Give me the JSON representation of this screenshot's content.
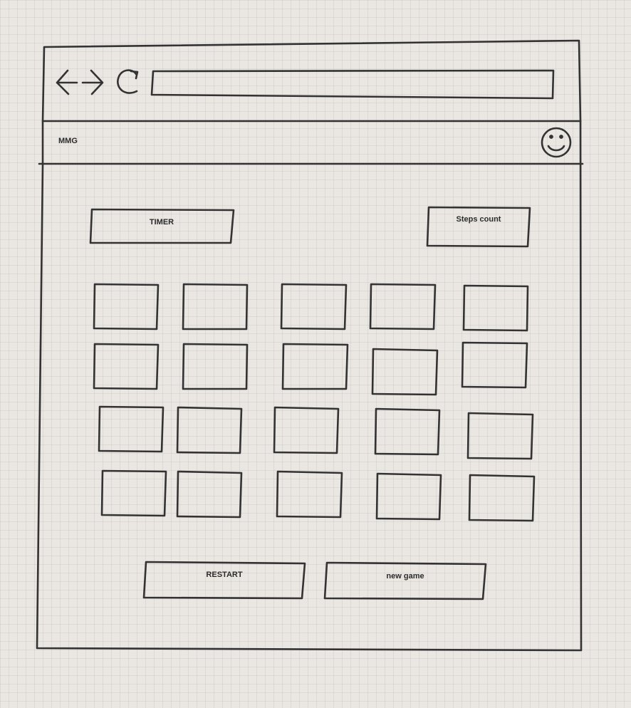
{
  "app": {
    "title": "MMG"
  },
  "browser": {
    "back_icon": "arrow-left-icon",
    "forward_icon": "arrow-right-icon",
    "reload_icon": "reload-icon",
    "address_value": ""
  },
  "header": {
    "avatar_icon": "smiley-face-icon"
  },
  "stats": {
    "timer_label": "TIMER",
    "steps_label": "Steps count"
  },
  "board": {
    "rows": 4,
    "columns": 5,
    "card_count": 20
  },
  "actions": {
    "restart_label": "RESTART",
    "new_game_label": "new game"
  }
}
